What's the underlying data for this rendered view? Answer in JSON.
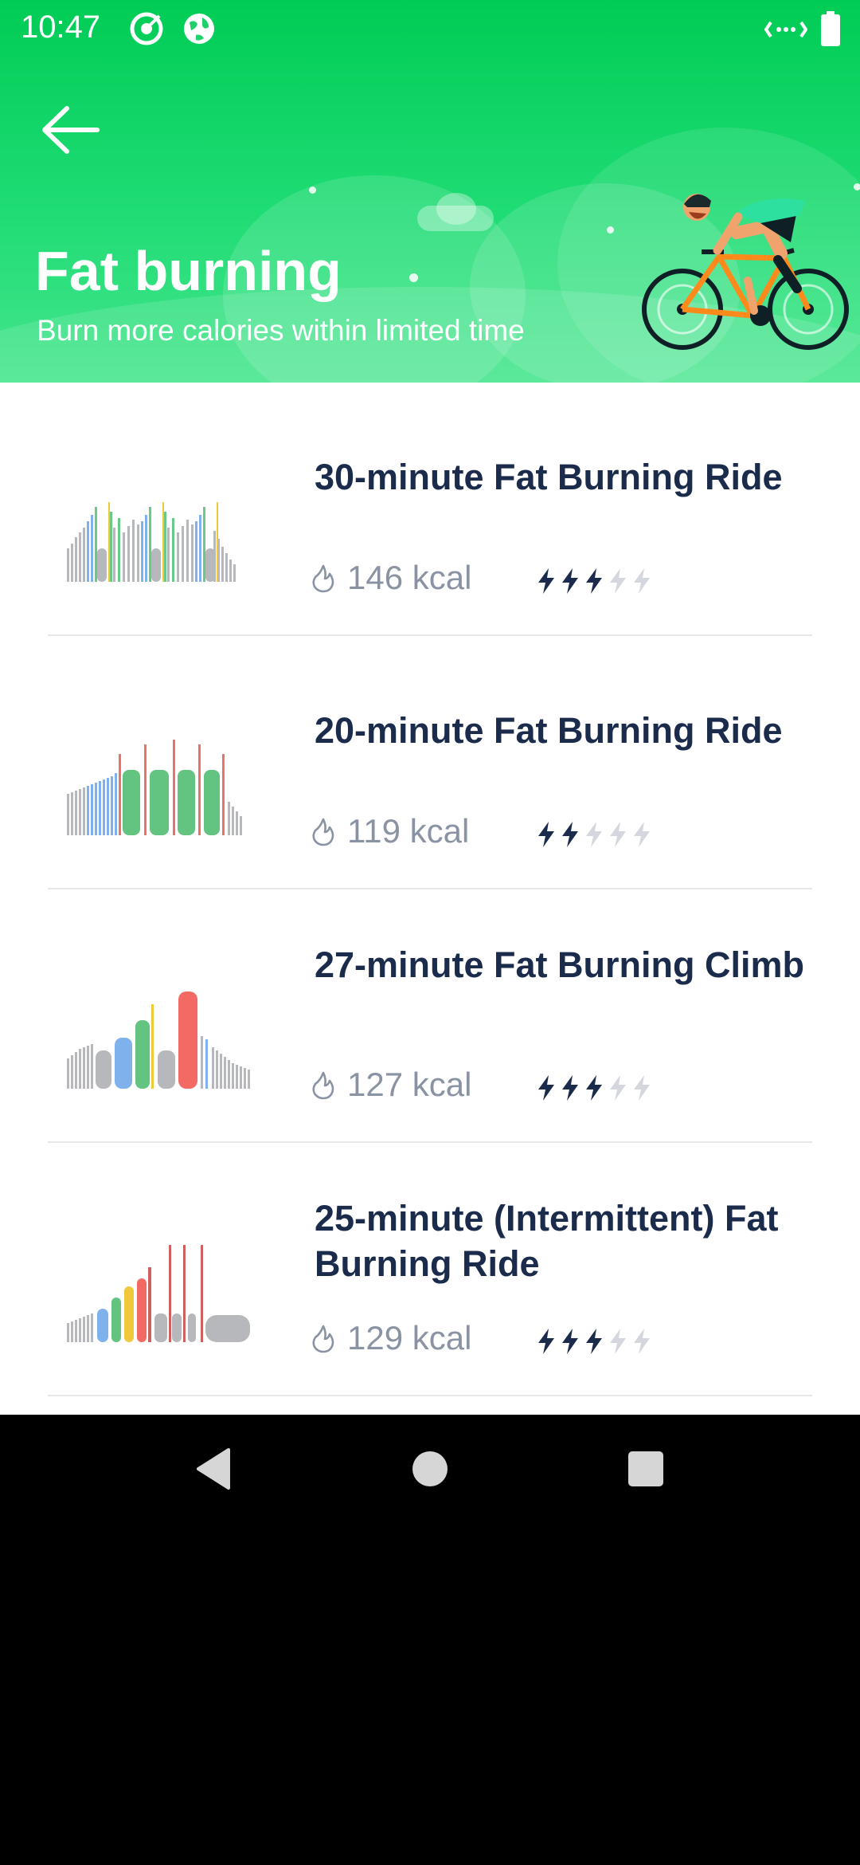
{
  "status_bar": {
    "time": "10:47",
    "icons": [
      "target-icon",
      "globe-icon",
      "signal-icon",
      "battery-icon"
    ]
  },
  "header": {
    "back_icon": "arrow-left-icon",
    "title": "Fat burning",
    "subtitle": "Burn more calories within limited time",
    "illustration": "cyclist-illustration"
  },
  "workouts": [
    {
      "title": "30-minute Fat Burning Ride",
      "kcal": "146 kcal",
      "intensity": 3,
      "intensity_max": 5
    },
    {
      "title": "20-minute Fat Burning Ride",
      "kcal": "119 kcal",
      "intensity": 2,
      "intensity_max": 5
    },
    {
      "title": "27-minute Fat Burning Climb",
      "kcal": "127 kcal",
      "intensity": 3,
      "intensity_max": 5
    },
    {
      "title": "25-minute (Intermittent) Fat Burning Ride",
      "kcal": "129 kcal",
      "intensity": 3,
      "intensity_max": 5
    }
  ],
  "nav_bar": {
    "buttons": [
      "back-triangle-icon",
      "home-circle-icon",
      "recents-square-icon"
    ]
  },
  "colors": {
    "header_green": "#00cc55",
    "title_navy": "#1b2b4b",
    "muted_gray": "#8a93a3",
    "bolt_active": "#1b2b4b",
    "bolt_inactive": "#d4d8de"
  }
}
